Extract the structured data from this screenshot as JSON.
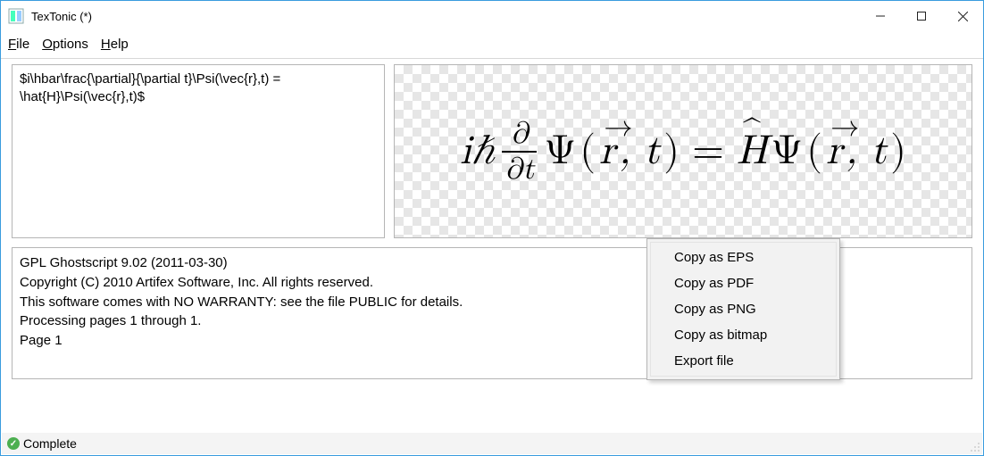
{
  "window": {
    "title": "TexTonic (*)"
  },
  "menu": {
    "file": "File",
    "file_ul": "F",
    "options": "Options",
    "options_ul": "O",
    "help": "Help",
    "help_ul": "H"
  },
  "input": {
    "text": "$i\\hbar\\frac{\\partial}{\\partial t}\\Psi(\\vec{r},t) = \\hat{H}\\Psi(\\vec{r},t)$"
  },
  "preview": {
    "literal": "iℏ ∂/∂t Ψ(r,t) = Ĥ Ψ(r,t)",
    "ih": "iℏ",
    "partial": "∂",
    "partial_t": "∂t",
    "psi": "Ψ",
    "lparen": "(",
    "r": "r",
    "comma_t": ", t",
    "rparen": ")",
    "eq": "=",
    "H": "H",
    "hat": "^",
    "vec": "→"
  },
  "log": {
    "lines": "GPL Ghostscript 9.02 (2011-03-30)\nCopyright (C) 2010 Artifex Software, Inc.  All rights reserved.\nThis software comes with NO WARRANTY: see the file PUBLIC for details.\nProcessing pages 1 through 1.\nPage 1"
  },
  "context_menu": {
    "items": [
      "Copy as EPS",
      "Copy as PDF",
      "Copy as PNG",
      "Copy as bitmap",
      "Export file"
    ]
  },
  "status": {
    "text": "Complete",
    "icon": "check-icon"
  }
}
